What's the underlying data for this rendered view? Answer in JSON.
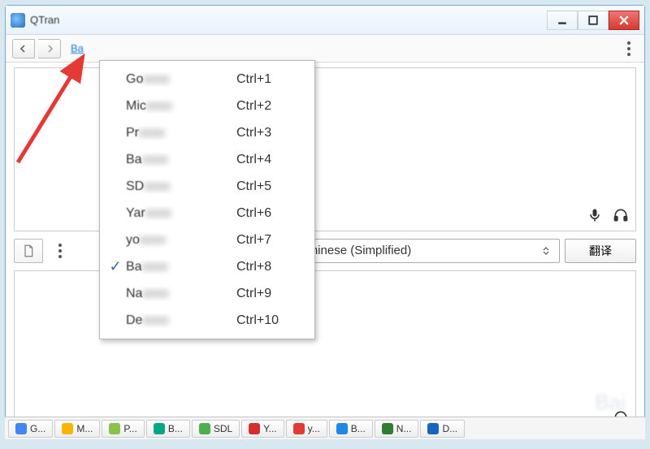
{
  "window": {
    "title": "QTran",
    "service_label": "Ba"
  },
  "dropdown": {
    "items": [
      {
        "checked": false,
        "label_prefix": "Go",
        "shortcut": "Ctrl+1"
      },
      {
        "checked": false,
        "label_prefix": "Mic",
        "shortcut": "Ctrl+2"
      },
      {
        "checked": false,
        "label_prefix": "Pr",
        "shortcut": "Ctrl+3"
      },
      {
        "checked": false,
        "label_prefix": "Ba",
        "shortcut": "Ctrl+4"
      },
      {
        "checked": false,
        "label_prefix": "SD",
        "shortcut": "Ctrl+5"
      },
      {
        "checked": false,
        "label_prefix": "Yar",
        "shortcut": "Ctrl+6"
      },
      {
        "checked": false,
        "label_prefix": "yo",
        "shortcut": "Ctrl+7"
      },
      {
        "checked": true,
        "label_prefix": "Ba",
        "shortcut": "Ctrl+8"
      },
      {
        "checked": false,
        "label_prefix": "Na",
        "shortcut": "Ctrl+9"
      },
      {
        "checked": false,
        "label_prefix": "De",
        "shortcut": "Ctrl+10"
      }
    ]
  },
  "midbar": {
    "lang_select_value": "Chinese (Simplified)",
    "translate_button": "翻译"
  },
  "taskbar": {
    "tabs": [
      {
        "label": "G...",
        "color": "#4285f4"
      },
      {
        "label": "M...",
        "color": "#f7b500"
      },
      {
        "label": "P...",
        "color": "#8bc34a"
      },
      {
        "label": "B...",
        "color": "#00a884"
      },
      {
        "label": "SDL",
        "color": "#4caf50"
      },
      {
        "label": "Y...",
        "color": "#d32f2f"
      },
      {
        "label": "y...",
        "color": "#e53935"
      },
      {
        "label": "B...",
        "color": "#1e88e5"
      },
      {
        "label": "N...",
        "color": "#2e7d32"
      },
      {
        "label": "D...",
        "color": "#1565c0"
      }
    ]
  }
}
